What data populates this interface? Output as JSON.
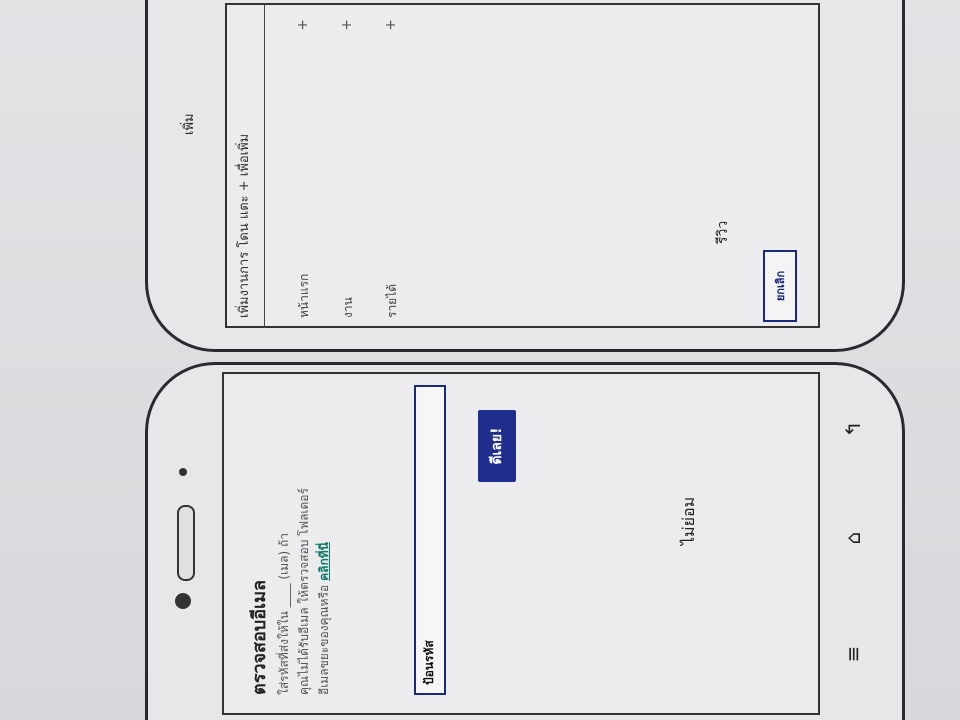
{
  "settings_screen": {
    "header_text": "เพิ่มงานการ โดน แตะ + เพื่อเพิ่ม",
    "top_label": "เพิ่ม",
    "rows": [
      {
        "label": "หน้าแรก",
        "action": "+"
      },
      {
        "label": "งาน",
        "action": "+"
      },
      {
        "label": "รายได้",
        "action": "+"
      }
    ],
    "caption": "รีวิว",
    "cancel_label": "ยกเลิก"
  },
  "verify_screen": {
    "title": "ตรวจสอบอีเมล",
    "description_line1": "ใส่รหัสที่ส่งให้ใน ____ (เมล) ถ้า",
    "description_line2": "คุณไม่ได้รับอีเมล ให้ตรวจสอบ โฟลเดอร์",
    "description_line3": "อีเมลขยะของคุณหรือ",
    "description_link": "คลิกที่นี่",
    "input_placeholder": "ป้อนรหัส",
    "ok_label": "ดีเลย!",
    "caption": "ไม่ย่อม"
  },
  "nav_keys": {
    "menu_icon": "≡",
    "home_icon": "⌂",
    "back_icon": "↰"
  },
  "colors": {
    "ink": "#222222",
    "accent_blue": "#1f2d8c",
    "link_green": "#137a6a"
  }
}
